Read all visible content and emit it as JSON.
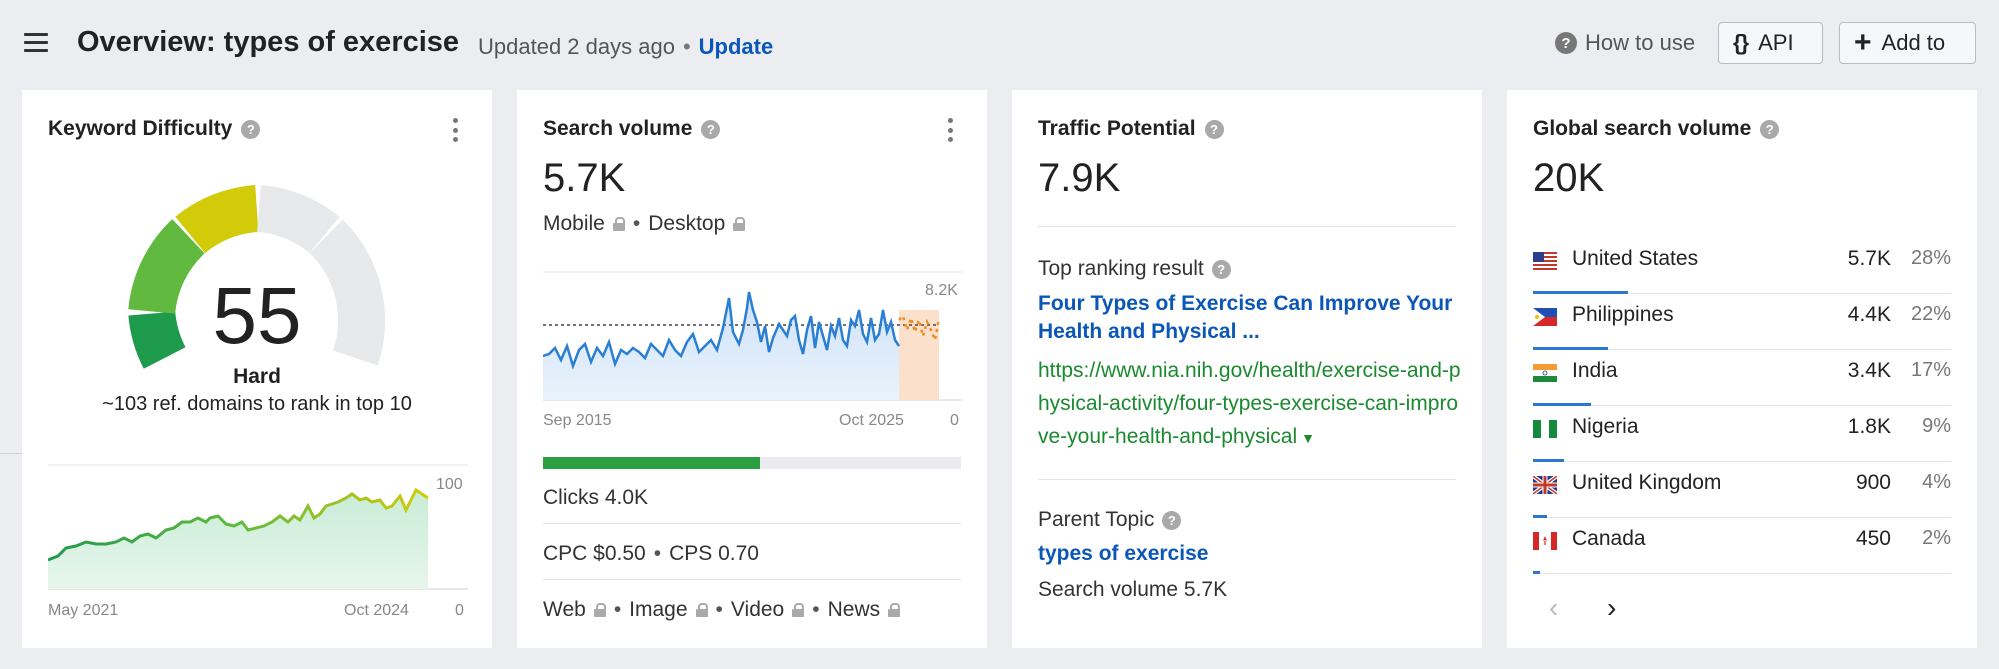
{
  "header": {
    "title": "Overview: types of exercise",
    "updated": "Updated 2 days ago",
    "update_link": "Update",
    "how_to_use": "How to use",
    "api_label": "API",
    "add_label": "Add to"
  },
  "keyword_difficulty": {
    "title": "Keyword Difficulty",
    "score": "55",
    "level": "Hard",
    "description": "~103 ref. domains to rank in top 10",
    "chart": {
      "start_label": "May 2021",
      "end_label": "Oct 2024",
      "y_max_label": "100",
      "y_min_label": "0"
    }
  },
  "search_volume": {
    "title": "Search volume",
    "value": "5.7K",
    "mobile": "Mobile",
    "desktop": "Desktop",
    "chart": {
      "start_label": "Sep 2015",
      "end_label": "Oct 2025",
      "y_max_label": "8.2K",
      "y_min_label": "0"
    },
    "clicks_progress": 0.52,
    "clicks": "Clicks 4.0K",
    "cpc": "CPC $0.50",
    "cps": "CPS 0.70",
    "types": [
      "Web",
      "Image",
      "Video",
      "News"
    ]
  },
  "traffic_potential": {
    "title": "Traffic Potential",
    "value": "7.9K",
    "top_result_label": "Top ranking result",
    "top_result_title": "Four Types of Exercise Can Improve Your Health and Physical ...",
    "top_result_url": "https://www.nia.nih.gov/health/exercise-and-physical-activity/four-types-exercise-can-improve-your-health-and-physical",
    "parent_topic_label": "Parent Topic",
    "parent_topic": "types of exercise",
    "parent_volume": "Search volume 5.7K"
  },
  "global_search_volume": {
    "title": "Global search volume",
    "value": "20K",
    "countries": [
      {
        "name": "United States",
        "volume": "5.7K",
        "percent": "28%",
        "share": 0.28
      },
      {
        "name": "Philippines",
        "volume": "4.4K",
        "percent": "22%",
        "share": 0.22
      },
      {
        "name": "India",
        "volume": "3.4K",
        "percent": "17%",
        "share": 0.17
      },
      {
        "name": "Nigeria",
        "volume": "1.8K",
        "percent": "9%",
        "share": 0.09
      },
      {
        "name": "United Kingdom",
        "volume": "900",
        "percent": "4%",
        "share": 0.04
      },
      {
        "name": "Canada",
        "volume": "450",
        "percent": "2%",
        "share": 0.02
      }
    ],
    "prev_icon": "chevron-left-icon",
    "next_icon": "chevron-right-icon"
  }
}
